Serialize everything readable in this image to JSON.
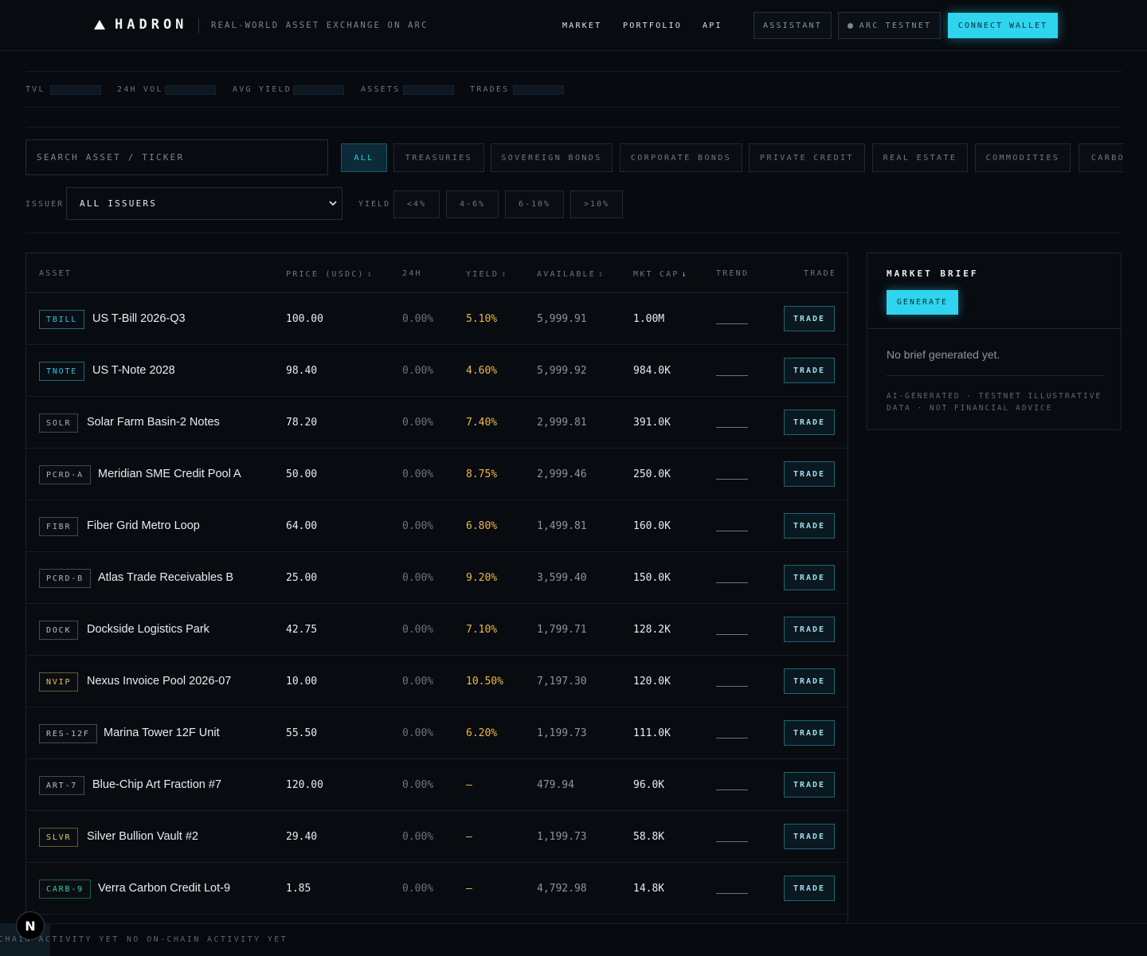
{
  "header": {
    "brand": "HADRON",
    "tagline": "REAL-WORLD ASSET EXCHANGE ON ARC",
    "nav": [
      "MARKET",
      "PORTFOLIO",
      "API"
    ],
    "assistant": "ASSISTANT",
    "network": "ARC TESTNET",
    "connect": "CONNECT WALLET"
  },
  "stats": [
    "TVL",
    "24H VOL",
    "AVG YIELD",
    "ASSETS",
    "TRADES"
  ],
  "filters": {
    "search_placeholder": "SEARCH ASSET / TICKER",
    "tabs": [
      "ALL",
      "TREASURIES",
      "SOVEREIGN BONDS",
      "CORPORATE BONDS",
      "PRIVATE CREDIT",
      "REAL ESTATE",
      "COMMODITIES",
      "CARBO"
    ],
    "issuer_label": "ISSUER",
    "issuer_value": "ALL ISSUERS",
    "yield_label": "YIELD",
    "yield_ranges": [
      "<4%",
      "4-6%",
      "6-10%",
      ">10%"
    ]
  },
  "table": {
    "columns": {
      "asset": "ASSET",
      "price": "PRICE (USDC)",
      "change": "24H",
      "yield": "YIELD",
      "available": "AVAILABLE",
      "mcap": "MKT CAP",
      "trend": "TREND",
      "trade": "TRADE"
    },
    "trade_label": "TRADE",
    "rows": [
      {
        "ticker": "TBILL",
        "name": "US T-Bill 2026-Q3",
        "price": "100.00",
        "change": "0.00%",
        "yield": "5.10%",
        "available": "5,999.91",
        "mcap": "1.00M",
        "style": "treas"
      },
      {
        "ticker": "TNOTE",
        "name": "US T-Note 2028",
        "price": "98.40",
        "change": "0.00%",
        "yield": "4.60%",
        "available": "5,999.92",
        "mcap": "984.0K",
        "style": "treas"
      },
      {
        "ticker": "SOLR",
        "name": "Solar Farm Basin-2 Notes",
        "price": "78.20",
        "change": "0.00%",
        "yield": "7.40%",
        "available": "2,999.81",
        "mcap": "391.0K",
        "style": "gray"
      },
      {
        "ticker": "PCRD-A",
        "name": "Meridian SME Credit Pool A",
        "price": "50.00",
        "change": "0.00%",
        "yield": "8.75%",
        "available": "2,999.46",
        "mcap": "250.0K",
        "style": "gray"
      },
      {
        "ticker": "FIBR",
        "name": "Fiber Grid Metro Loop",
        "price": "64.00",
        "change": "0.00%",
        "yield": "6.80%",
        "available": "1,499.81",
        "mcap": "160.0K",
        "style": "gray"
      },
      {
        "ticker": "PCRD-B",
        "name": "Atlas Trade Receivables B",
        "price": "25.00",
        "change": "0.00%",
        "yield": "9.20%",
        "available": "3,599.40",
        "mcap": "150.0K",
        "style": "gray"
      },
      {
        "ticker": "DOCK",
        "name": "Dockside Logistics Park",
        "price": "42.75",
        "change": "0.00%",
        "yield": "7.10%",
        "available": "1,799.71",
        "mcap": "128.2K",
        "style": "slate"
      },
      {
        "ticker": "NVIP",
        "name": "Nexus Invoice Pool 2026-07",
        "price": "10.00",
        "change": "0.00%",
        "yield": "10.50%",
        "available": "7,197.30",
        "mcap": "120.0K",
        "style": "yellow"
      },
      {
        "ticker": "RES-12F",
        "name": "Marina Tower 12F Unit",
        "price": "55.50",
        "change": "0.00%",
        "yield": "6.20%",
        "available": "1,199.73",
        "mcap": "111.0K",
        "style": "slate"
      },
      {
        "ticker": "ART-7",
        "name": "Blue-Chip Art Fraction #7",
        "price": "120.00",
        "change": "0.00%",
        "yield": "—",
        "available": "479.94",
        "mcap": "96.0K",
        "style": "slate"
      },
      {
        "ticker": "SLVR",
        "name": "Silver Bullion Vault #2",
        "price": "29.40",
        "change": "0.00%",
        "yield": "—",
        "available": "1,199.73",
        "mcap": "58.8K",
        "style": "yellow"
      },
      {
        "ticker": "CARB-9",
        "name": "Verra Carbon Credit Lot-9",
        "price": "1.85",
        "change": "0.00%",
        "yield": "—",
        "available": "4,792.98",
        "mcap": "14.8K",
        "style": "green"
      }
    ]
  },
  "brief": {
    "title": "MARKET BRIEF",
    "generate": "GENERATE",
    "empty": "No brief generated yet.",
    "note": "AI-GENERATED · TESTNET ILLUSTRATIVE DATA · NOT FINANCIAL ADVICE"
  },
  "footer": {
    "items": [
      "CHAIN ACTIVITY YET",
      "NO ON-CHAIN ACTIVITY YET"
    ],
    "badge": "N"
  },
  "colors": {
    "accent": "#2fd4ee",
    "background": "#070a0f",
    "yield": "#f0b843"
  }
}
